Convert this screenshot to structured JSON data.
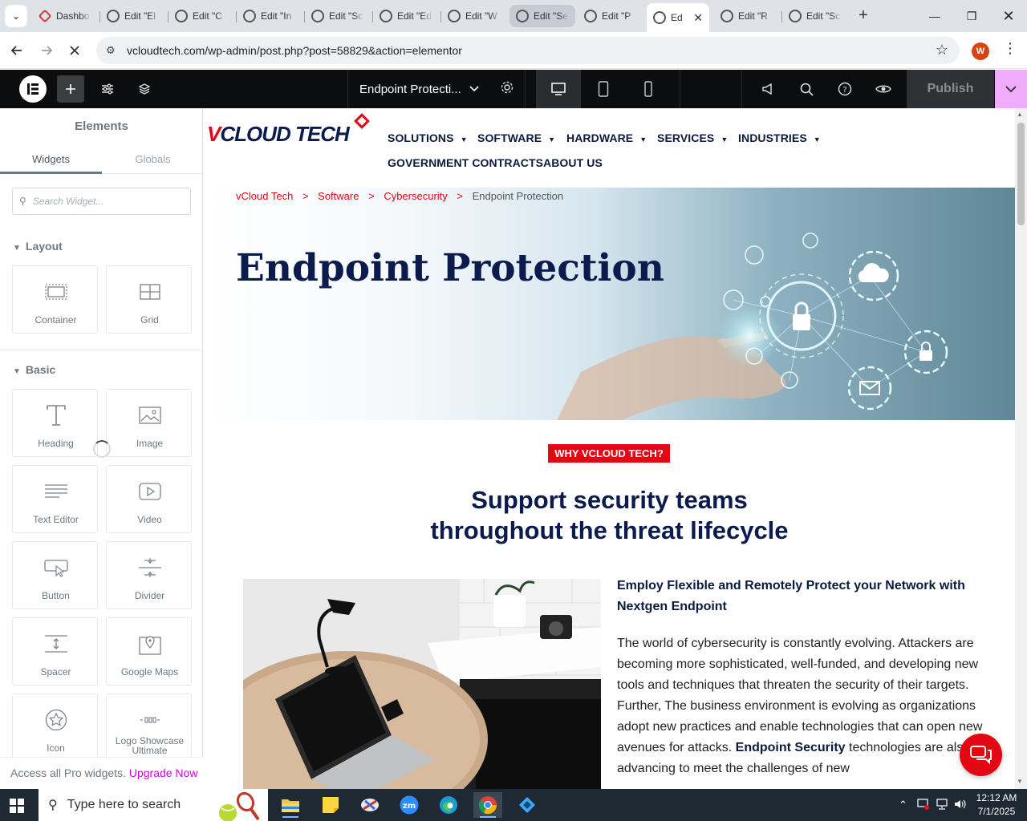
{
  "browser": {
    "tabs": [
      {
        "label": "Dashbo",
        "icon": "wordpress-red-icon"
      },
      {
        "label": "Edit \"El",
        "icon": "wordpress-icon"
      },
      {
        "label": "Edit \"C",
        "icon": "wordpress-icon"
      },
      {
        "label": "Edit \"In",
        "icon": "wordpress-icon"
      },
      {
        "label": "Edit \"Sc",
        "icon": "wordpress-icon"
      },
      {
        "label": "Edit \"Ed",
        "icon": "wordpress-icon"
      },
      {
        "label": "Edit \"W",
        "icon": "wordpress-icon"
      },
      {
        "label": "Edit \"Se",
        "icon": "wordpress-icon"
      },
      {
        "label": "Edit \"P",
        "icon": "wordpress-icon"
      },
      {
        "label": "Ed",
        "icon": "loading-icon"
      },
      {
        "label": "Edit \"R",
        "icon": "wordpress-icon"
      },
      {
        "label": "Edit \"Sc",
        "icon": "wordpress-icon"
      }
    ],
    "url": "vcloudtech.com/wp-admin/post.php?post=58829&action=elementor",
    "profile_initial": "W"
  },
  "elementor": {
    "doc_title": "Endpoint Protecti...",
    "publish_label": "Publish"
  },
  "panel": {
    "title": "Elements",
    "tabs": [
      "Widgets",
      "Globals"
    ],
    "search_placeholder": "Search Widget...",
    "categories": {
      "layout": "Layout",
      "basic": "Basic"
    },
    "widgets": {
      "container": "Container",
      "grid": "Grid",
      "heading": "Heading",
      "image": "Image",
      "text_editor": "Text Editor",
      "video": "Video",
      "button": "Button",
      "divider": "Divider",
      "spacer": "Spacer",
      "google_maps": "Google Maps",
      "icon": "Icon",
      "logo_showcase_1": "Logo Showcase",
      "logo_showcase_2": "Ultimate"
    },
    "pro_text": "Access all Pro widgets.",
    "upgrade": "Upgrade Now"
  },
  "site": {
    "logo_v": "V",
    "logo_rest": "CLOUD TECH",
    "nav": {
      "solutions": "SOLUTIONS",
      "software": "SOFTWARE",
      "hardware": "HARDWARE",
      "services": "SERVICES",
      "industries": "INDUSTRIES",
      "government": "GOVERNMENT CONTRACTS",
      "about": "ABOUT US"
    },
    "breadcrumb": {
      "home": "vCloud Tech",
      "software": "Software",
      "cyber": "Cybersecurity",
      "current": "Endpoint Protection",
      "sep": ">"
    },
    "hero_title": "Endpoint Protection",
    "why_badge": "WHY VCLOUD TECH?",
    "support_line1": "Support security teams",
    "support_line2": "throughout the threat lifecycle",
    "content_heading": "Employ Flexible and Remotely Protect your Network with Nextgen Endpoint",
    "content_body": "The world of cybersecurity is constantly evolving. Attackers are becoming more sophisticated, well-funded, and developing new tools and techniques that threaten the security of their targets. Further, The business environment is evolving as organizations adopt new practices and enable technologies that can open new avenues for attacks.",
    "content_bold": "Endpoint Security",
    "content_tail": "technologies are also advancing to meet the challenges of new"
  },
  "taskbar": {
    "search_placeholder": "Type here to search",
    "time": "12:12 AM",
    "date": "7/1/2025"
  }
}
